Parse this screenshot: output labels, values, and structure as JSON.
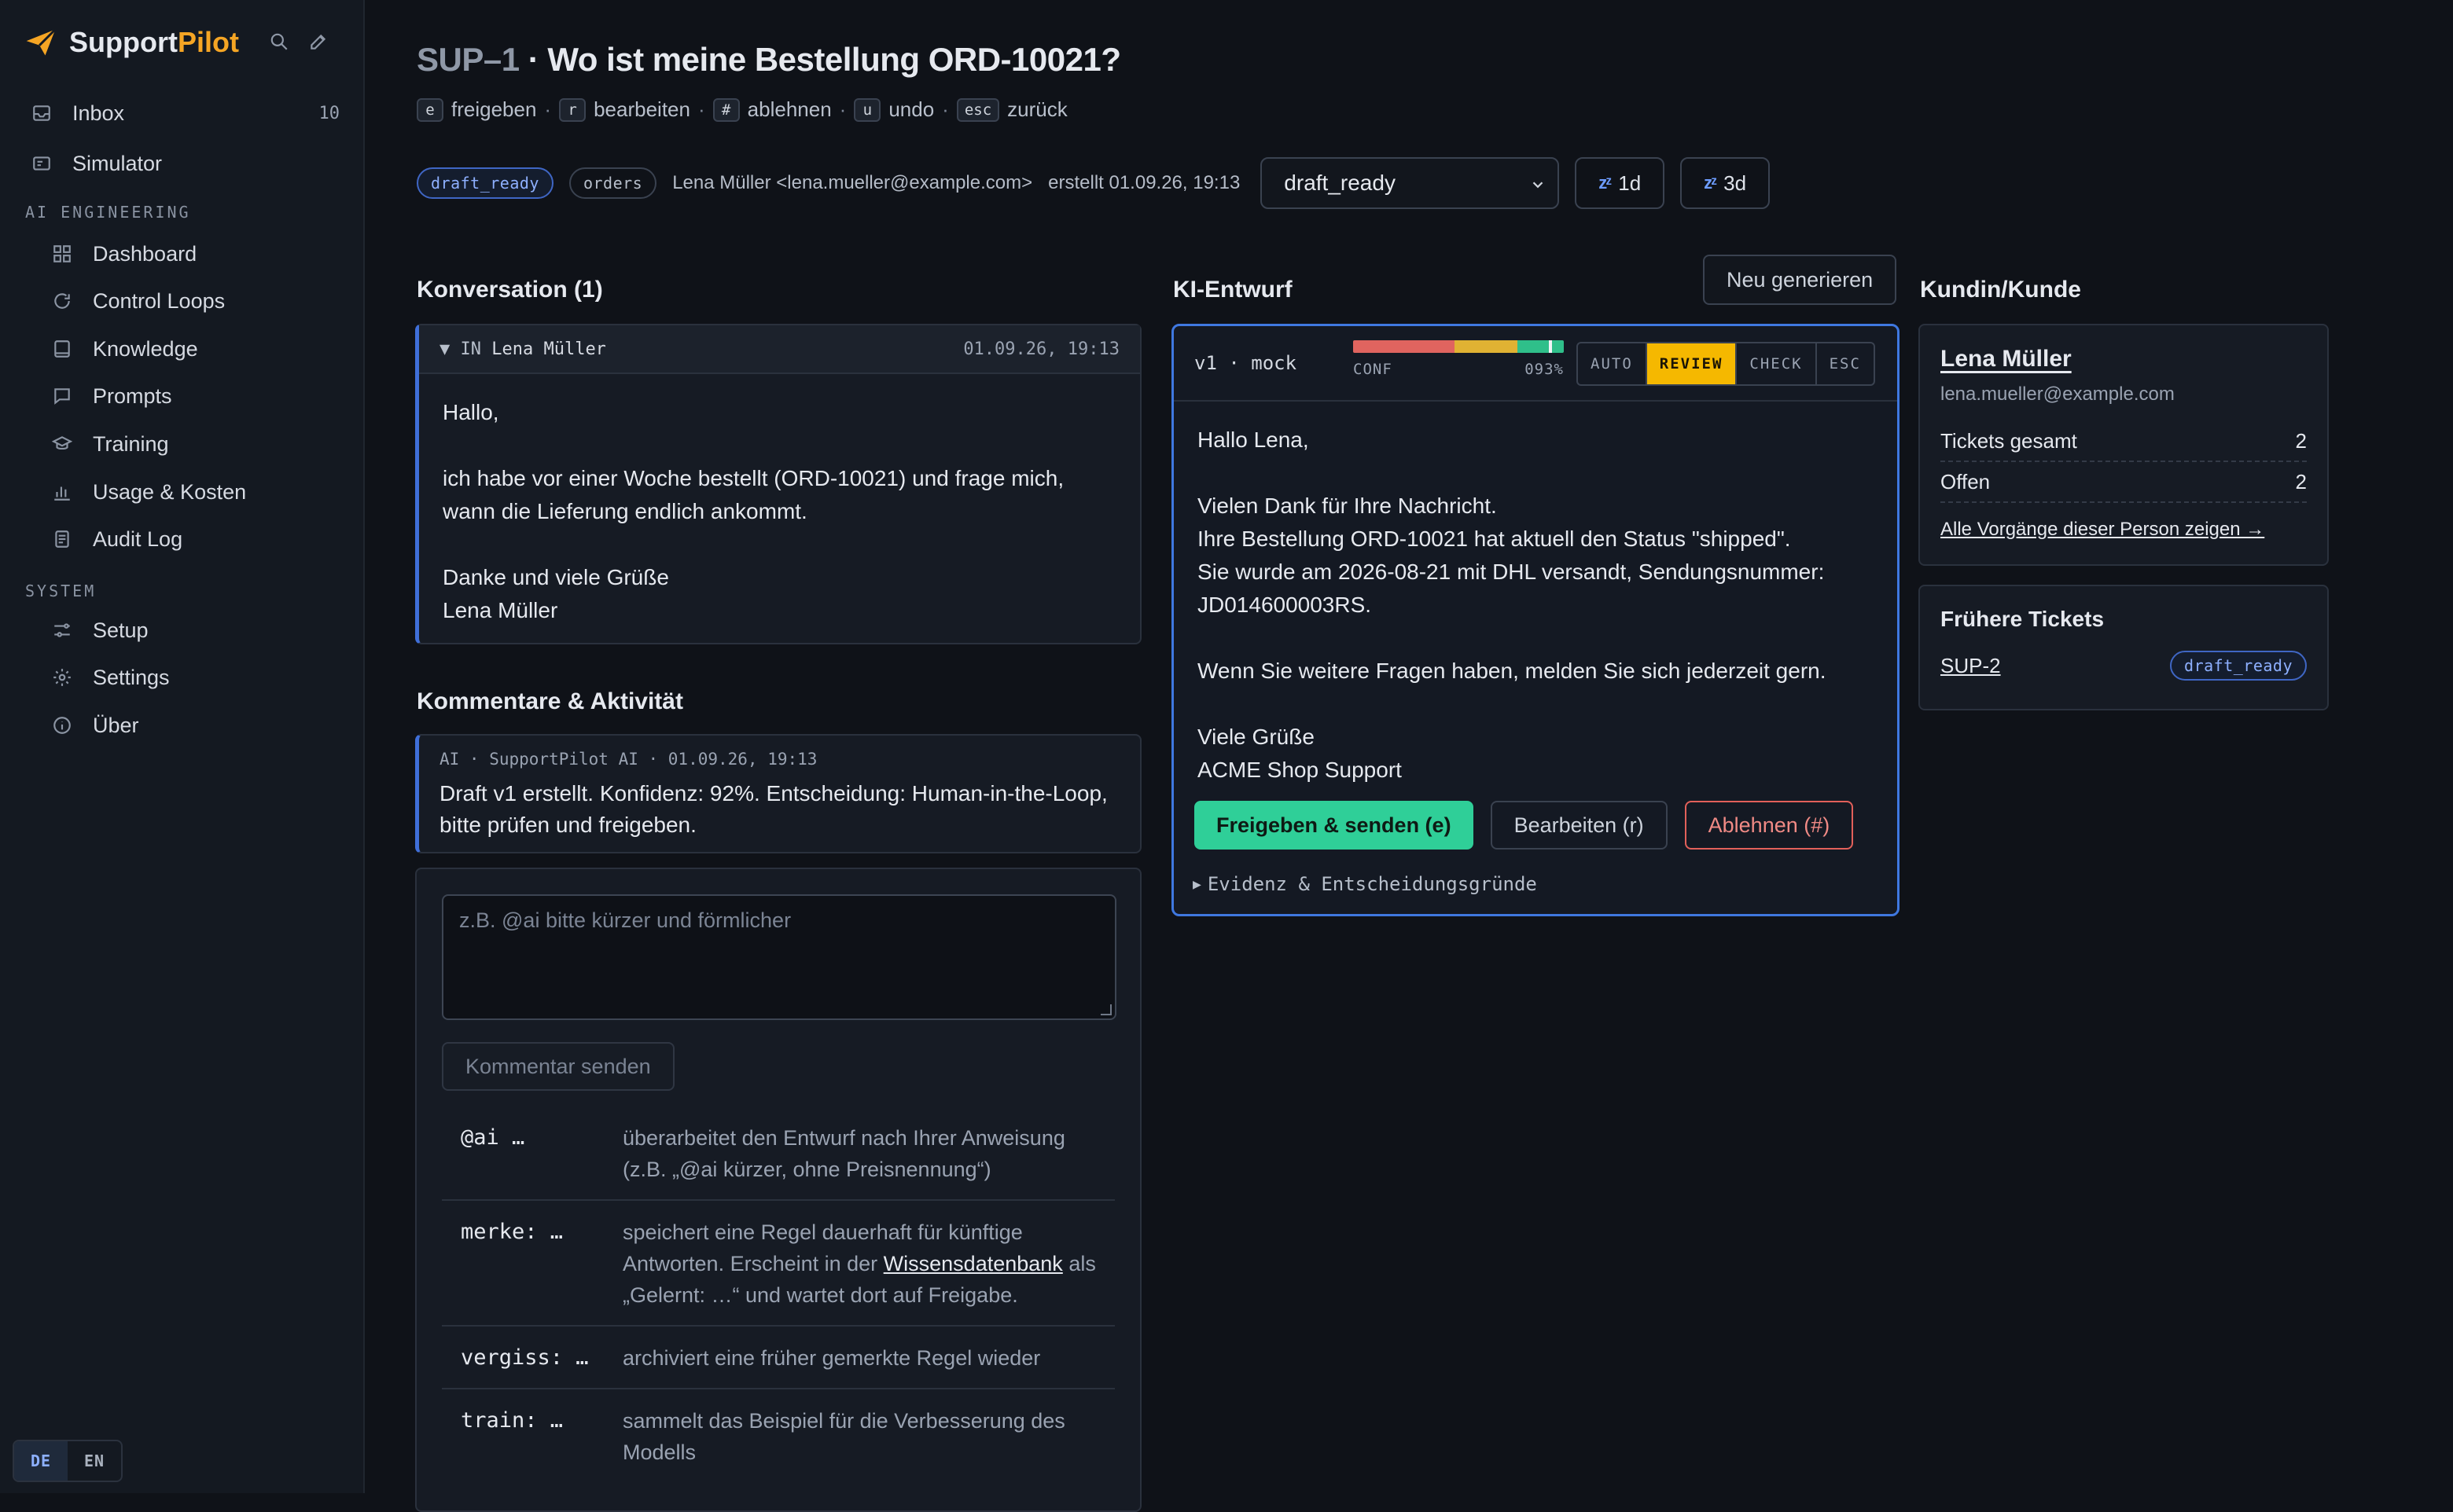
{
  "app": {
    "brand_a": "Support",
    "brand_b": "Pilot"
  },
  "nav": {
    "inbox": {
      "label": "Inbox",
      "count": "10"
    },
    "simulator": {
      "label": "Simulator"
    },
    "section_ai": "AI ENGINEERING",
    "ai_items": [
      {
        "label": "Dashboard",
        "icon": "grid-icon"
      },
      {
        "label": "Control Loops",
        "icon": "refresh-icon"
      },
      {
        "label": "Knowledge",
        "icon": "book-icon"
      },
      {
        "label": "Prompts",
        "icon": "chat-icon"
      },
      {
        "label": "Training",
        "icon": "graduation-cap-icon"
      },
      {
        "label": "Usage & Kosten",
        "icon": "bar-chart-icon"
      },
      {
        "label": "Audit Log",
        "icon": "document-icon"
      }
    ],
    "section_system": "SYSTEM",
    "system_items": [
      {
        "label": "Setup",
        "icon": "sliders-icon"
      },
      {
        "label": "Settings",
        "icon": "gear-icon"
      },
      {
        "label": "Über",
        "icon": "info-icon"
      }
    ],
    "lang": [
      "DE",
      "EN"
    ]
  },
  "ticket": {
    "id": "SUP–1",
    "title": " · Wo ist meine Bestellung ORD-10021?",
    "shortcuts": [
      {
        "key": "e",
        "label": "freigeben"
      },
      {
        "key": "r",
        "label": "bearbeiten"
      },
      {
        "key": "#",
        "label": "ablehnen"
      },
      {
        "key": "u",
        "label": "undo"
      },
      {
        "key": "esc",
        "label": "zurück"
      }
    ],
    "status_pill": "draft_ready",
    "tag_pill": "orders",
    "requester": "Lena Müller <lena.mueller@example.com>",
    "created": "erstellt 01.09.26, 19:13",
    "status_select": "draft_ready",
    "snooze_1": "1d",
    "snooze_2": "3d"
  },
  "conversation": {
    "heading": "Konversation (1)",
    "direction": "▼ IN",
    "author": "Lena Müller",
    "datetime": "01.09.26, 19:13",
    "p1": "Hallo,",
    "p2": "ich habe vor einer Woche bestellt (ORD-10021) und frage mich, wann die Lieferung endlich ankommt.",
    "p3a": "Danke und viele Grüße",
    "p3b": "Lena Müller"
  },
  "activity": {
    "heading": "Kommentare & Aktivität",
    "meta": "AI · SupportPilot AI · 01.09.26, 19:13",
    "text": "Draft v1 erstellt. Konfidenz: 92%. Entscheidung: Human-in-the-Loop, bitte prüfen und freigeben.",
    "placeholder": "z.B. @ai bitte kürzer und förmlicher",
    "send": "Kommentar senden",
    "commands": [
      {
        "k": "@ai …",
        "v": "überarbeitet den Entwurf nach Ihrer Anweisung (z.B. „@ai kürzer, ohne Preisnennung“)"
      },
      {
        "k": "merke: …",
        "v1": "speichert eine Regel dauerhaft für künftige Antworten. Erscheint in der ",
        "link": "Wissensdatenbank",
        "v2": " als „Gelernt: …“ und wartet dort auf Freigabe."
      },
      {
        "k": "vergiss: …",
        "v": "archiviert eine früher gemerkte Regel wieder"
      },
      {
        "k": "train: …",
        "v": "sammelt das Beispiel für die Verbesserung des Modells"
      }
    ]
  },
  "draft": {
    "heading": "KI-Entwurf",
    "regenerate": "Neu generieren",
    "version": "v1 · mock",
    "conf_label": "CONF",
    "conf_value": "093%",
    "conf_fraction": 0.93,
    "modes": [
      "AUTO",
      "REVIEW",
      "CHECK",
      "ESC"
    ],
    "active_mode": "REVIEW",
    "greeting": "Hallo Lena,",
    "l1": "Vielen Dank für Ihre Nachricht.",
    "l2": "Ihre Bestellung ORD-10021 hat aktuell den Status \"shipped\".",
    "l3": "Sie wurde am 2026-08-21 mit DHL versandt, Sendungsnummer: JD014600003RS.",
    "l4": "Wenn Sie weitere Fragen haben, melden Sie sich jederzeit gern.",
    "l5a": "Viele Grüße",
    "l5b": "ACME Shop Support",
    "approve": "Freigeben & senden (e)",
    "edit": "Bearbeiten (r)",
    "reject": "Ablehnen (#)",
    "evidence": "Evidenz & Entscheidungsgründe"
  },
  "customer": {
    "heading": "Kundin/Kunde",
    "name": "Lena Müller",
    "email": "lena.mueller@example.com",
    "tickets_label": "Tickets gesamt",
    "tickets_value": "2",
    "open_label": "Offen",
    "open_value": "2",
    "all_link": "Alle Vorgänge dieser Person zeigen →",
    "prev_heading": "Frühere Tickets",
    "prev_id": "SUP-2",
    "prev_status": "draft_ready"
  },
  "colors": {
    "accent": "#3f78e0",
    "brand": "#f5a524",
    "approve": "#2fcf98",
    "reject": "#e2605a",
    "review": "#f5b800"
  }
}
